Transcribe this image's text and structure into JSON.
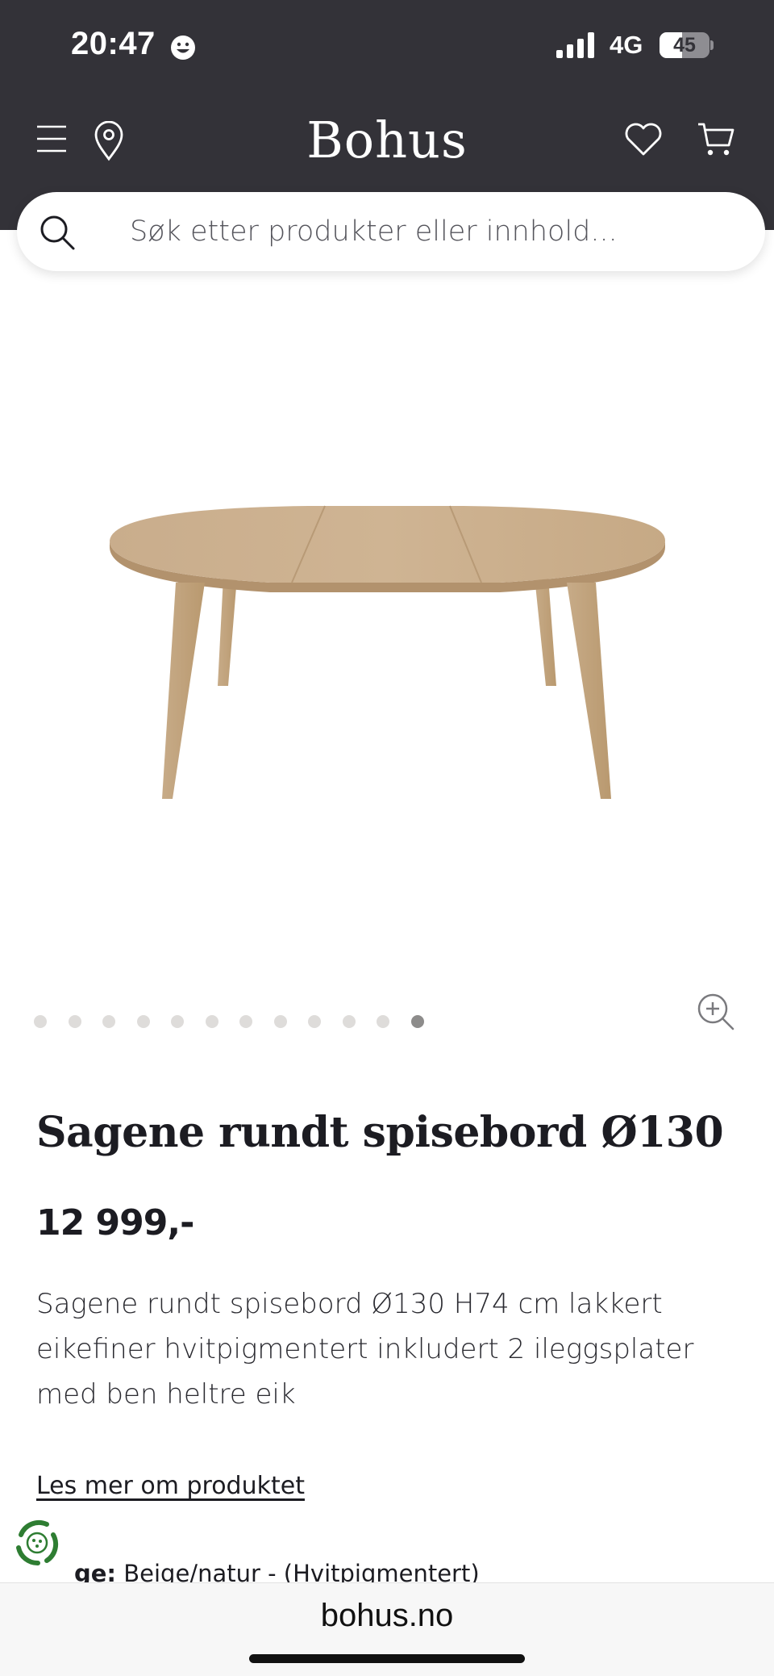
{
  "status_bar": {
    "time": "20:47",
    "network": "4G",
    "battery": "45",
    "battery_level": 0.45
  },
  "header": {
    "logo": "Bohus",
    "icons": [
      "menu-icon",
      "location-pin-icon",
      "heart-icon",
      "cart-icon"
    ]
  },
  "search": {
    "placeholder": "Søk etter produkter eller innhold..."
  },
  "gallery": {
    "image_count": 12,
    "active_index": 11
  },
  "product": {
    "title": "Sagene rundt spisebord Ø130",
    "price": "12 999,-",
    "description": "Sagene rundt spisebord Ø130 H74 cm lakkert eikefiner hvitpigmentert inkludert 2 ileggsplater med ben heltre eik",
    "more_link": "Les mer om produktet",
    "color_label": "ge:",
    "color_value": "Beige/natur - (Hvitpigmentert)"
  },
  "browser": {
    "url": "bohus.no"
  },
  "colors": {
    "header_bg": "#333238",
    "gallery_bg": "#f4f2f0",
    "text": "#1c1c22",
    "eco_green": "#2e7d32"
  }
}
